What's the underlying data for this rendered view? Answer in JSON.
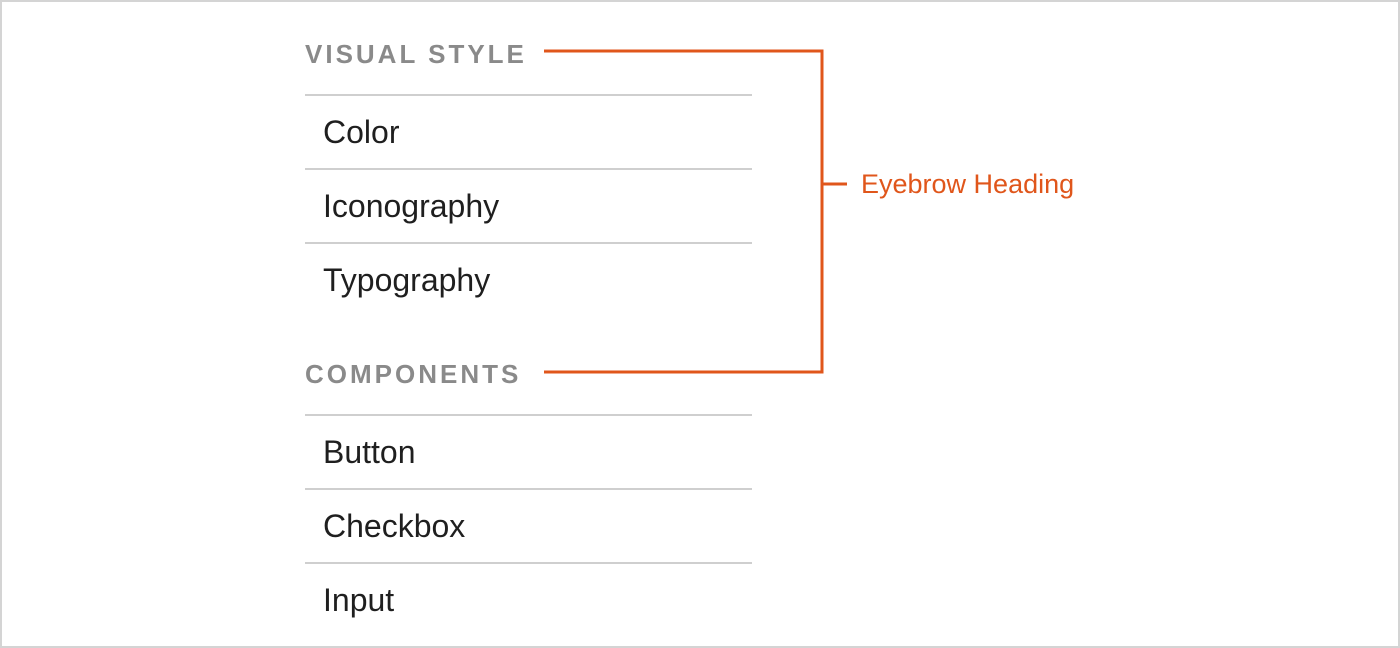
{
  "colors": {
    "eyebrow": "#8a8a8a",
    "accent": "#e0561b",
    "item_text": "#1f1f1f",
    "divider": "#cfcfcf",
    "border": "#d4d4d4"
  },
  "sections": [
    {
      "eyebrow": "VISUAL STYLE",
      "items": [
        "Color",
        "Iconography",
        "Typography"
      ]
    },
    {
      "eyebrow": "COMPONENTS",
      "items": [
        "Button",
        "Checkbox",
        "Input"
      ]
    }
  ],
  "annotation": {
    "label": "Eyebrow Heading"
  }
}
